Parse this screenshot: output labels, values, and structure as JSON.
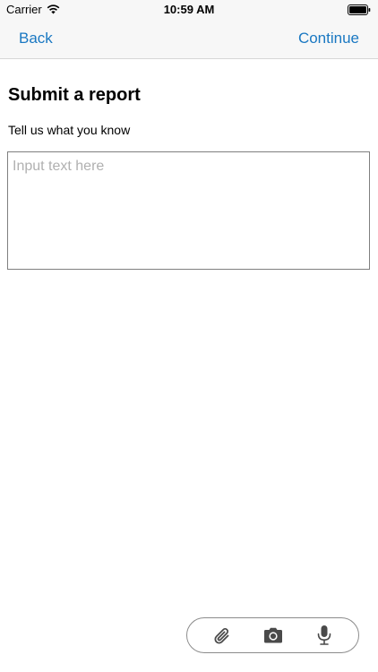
{
  "status_bar": {
    "carrier": "Carrier",
    "time": "10:59 AM",
    "icons": [
      "wifi-icon",
      "battery-icon"
    ]
  },
  "nav": {
    "back_label": "Back",
    "continue_label": "Continue",
    "accent_color": "#1a78c2"
  },
  "report": {
    "title": "Submit a report",
    "prompt": "Tell us what you know",
    "input": {
      "value": "",
      "placeholder": "Input text here"
    }
  },
  "attachments": {
    "icons": [
      "paperclip-icon",
      "camera-icon",
      "microphone-icon"
    ]
  }
}
